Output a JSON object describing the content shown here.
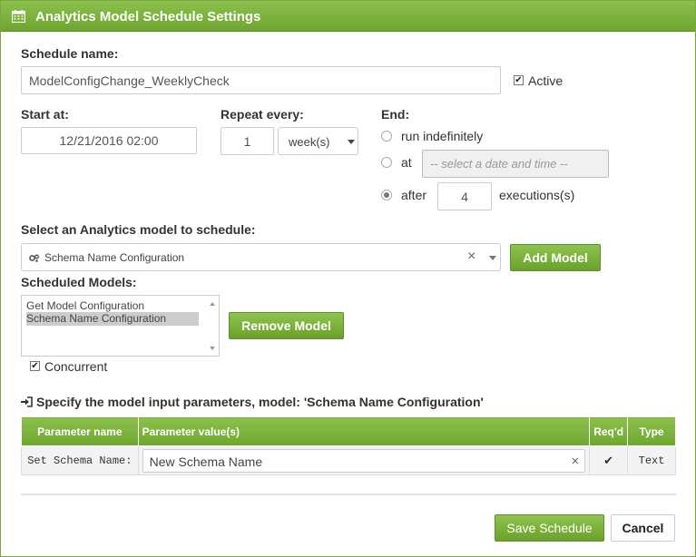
{
  "dialog": {
    "title": "Analytics Model Schedule Settings",
    "icon": "calendar-icon",
    "accent_color": "#7ab13c"
  },
  "schedule": {
    "name_label": "Schedule name:",
    "name_value": "ModelConfigChange_WeeklyCheck",
    "active_label": "Active",
    "active_checked": true
  },
  "start": {
    "label": "Start at:",
    "value": "12/21/2016 02:00"
  },
  "repeat": {
    "label": "Repeat every:",
    "value": "1",
    "unit": "week(s)"
  },
  "end": {
    "label": "End:",
    "option_indefinitely": "run indefinitely",
    "option_at": "at",
    "at_placeholder": "-- select a date and time --",
    "option_after": "after",
    "after_value": "4",
    "after_suffix": "executions(s)",
    "selected": "after"
  },
  "model_select": {
    "label": "Select an Analytics model to schedule:",
    "selected": "Schema Name Configuration",
    "clear_glyph": "×",
    "icon": "gears-icon",
    "add_button": "Add Model"
  },
  "scheduled_models": {
    "label": "Scheduled Models:",
    "items": [
      "Get Model Configuration",
      "Schema Name Configuration"
    ],
    "selected_index": 1,
    "remove_button": "Remove Model",
    "concurrent_label": "Concurrent",
    "concurrent_checked": true
  },
  "params": {
    "heading": "Specify the model input parameters, model: 'Schema Name Configuration'",
    "heading_icon": "sign-in-icon",
    "columns": [
      "Parameter name",
      "Parameter value(s)",
      "Req'd",
      "Type"
    ],
    "rows": [
      {
        "name": "Set Schema Name:",
        "value": "New Schema Name",
        "required": "✔",
        "type": "Text"
      }
    ]
  },
  "footer": {
    "save_button": "Save Schedule",
    "cancel_button": "Cancel"
  }
}
